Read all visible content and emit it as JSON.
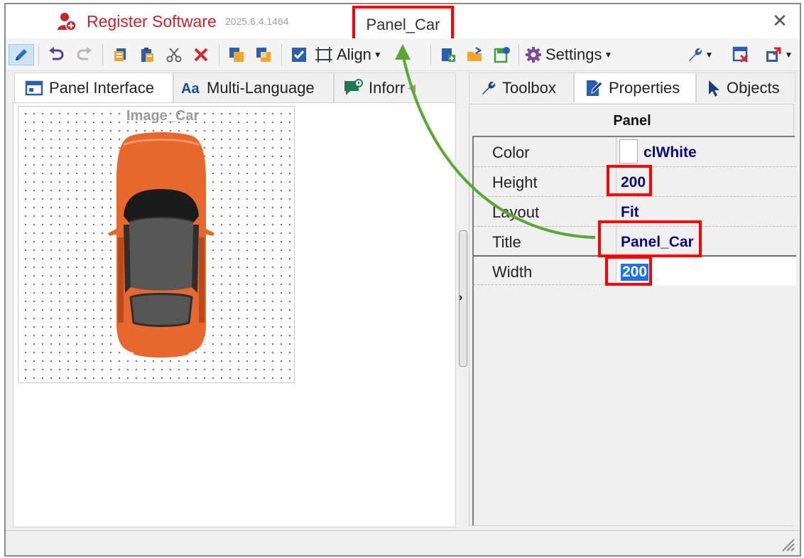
{
  "window": {
    "app_title": "Register Software",
    "version": "2025.6.4.1464",
    "document_title": "Panel_Car",
    "close_glyph": "✕"
  },
  "toolbar": {
    "align_label": "Align",
    "settings_label": "Settings",
    "icons": [
      "edit-mode-icon",
      "undo-icon",
      "redo-icon",
      "copy-icon",
      "paste-icon",
      "cut-icon",
      "delete-icon",
      "bring-to-front-icon",
      "send-to-back-icon",
      "select-all-icon",
      "align-icon",
      "add-panel-icon",
      "open-folder-icon",
      "export-icon",
      "settings-gear-icon",
      "tools-wrench-icon",
      "close-panel-icon",
      "window-export-icon"
    ]
  },
  "left_tabs": [
    {
      "label": "Panel Interface",
      "icon": "panel-interface-icon",
      "active": true
    },
    {
      "label": "Multi-Language",
      "icon": "multi-language-icon",
      "active": false
    },
    {
      "label": "Inforr",
      "icon": "information-icon",
      "active": false
    }
  ],
  "designer": {
    "image_caption": "Image_Car",
    "image": "car-top-view"
  },
  "right_tabs": [
    {
      "label": "Toolbox",
      "icon": "wrench-icon",
      "active": false
    },
    {
      "label": "Properties",
      "icon": "properties-icon",
      "active": true
    },
    {
      "label": "Objects",
      "icon": "cursor-icon",
      "active": false
    }
  ],
  "properties": {
    "heading": "Panel",
    "rows": [
      {
        "name": "Color",
        "value": "clWhite"
      },
      {
        "name": "Height",
        "value": "200"
      },
      {
        "name": "Layout",
        "value": "Fit"
      },
      {
        "name": "Title",
        "value": "Panel_Car"
      },
      {
        "name": "Width",
        "value": "200"
      }
    ]
  },
  "colors": {
    "highlight": "#ff0000",
    "arrow": "#5aa832",
    "app_title": "#c8242b",
    "value_text": "#0a0a78",
    "selection": "#1a73e8"
  }
}
